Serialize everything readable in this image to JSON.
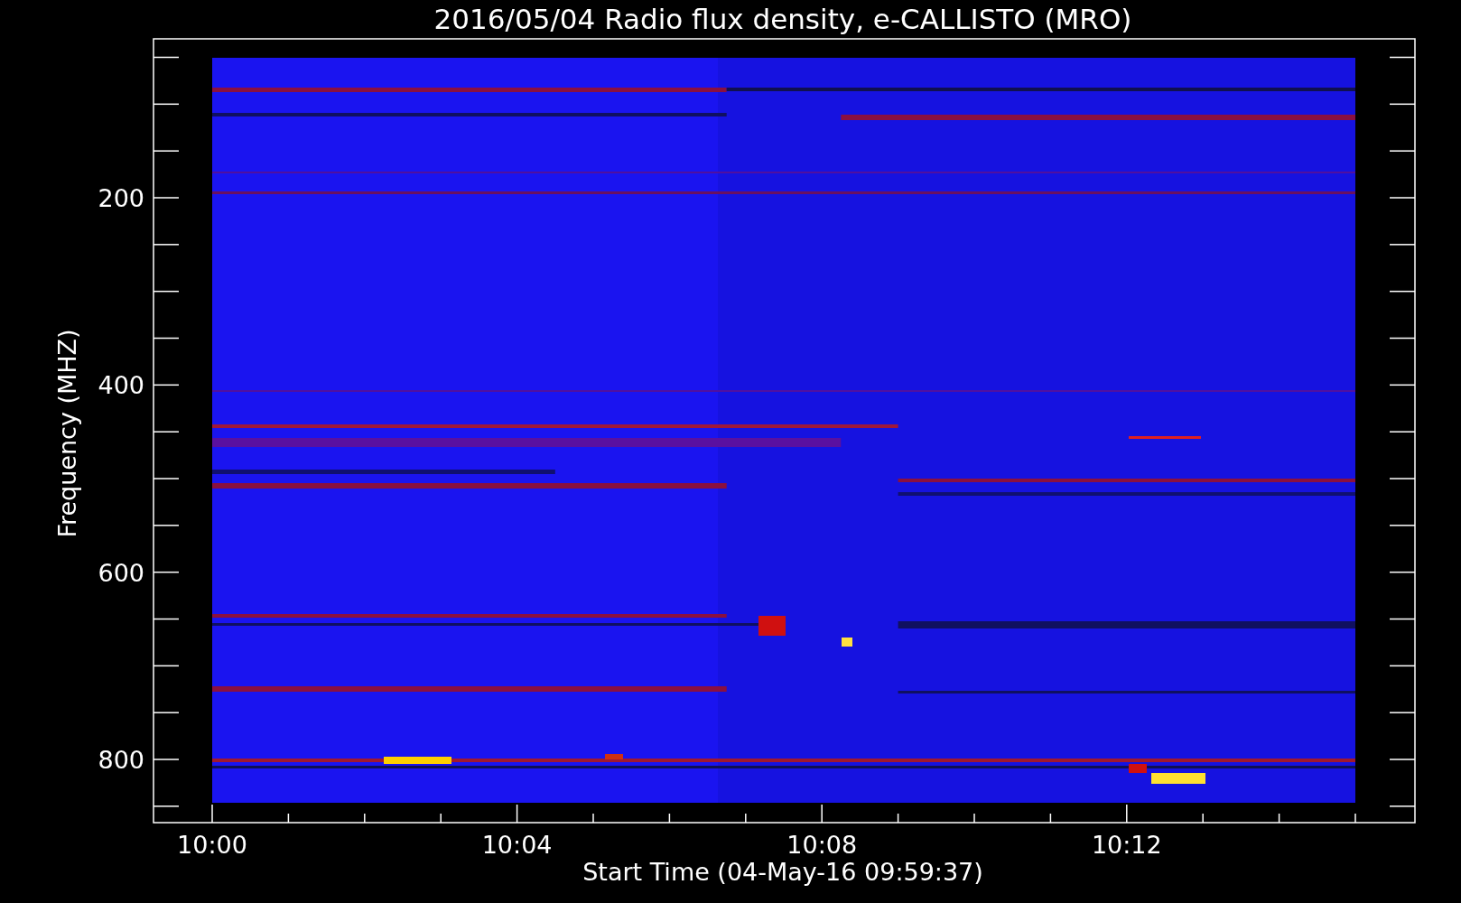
{
  "plot": {
    "title": "2016/05/04  Radio flux density, e-CALLISTO (MRO)",
    "xlabel": "Start Time (04-May-16 09:59:37)",
    "ylabel": "Frequency (MHZ)",
    "x_tick_labels": [
      "10:00",
      "10:04",
      "10:08",
      "10:12"
    ],
    "y_tick_labels": [
      "200",
      "400",
      "600",
      "800"
    ]
  }
}
